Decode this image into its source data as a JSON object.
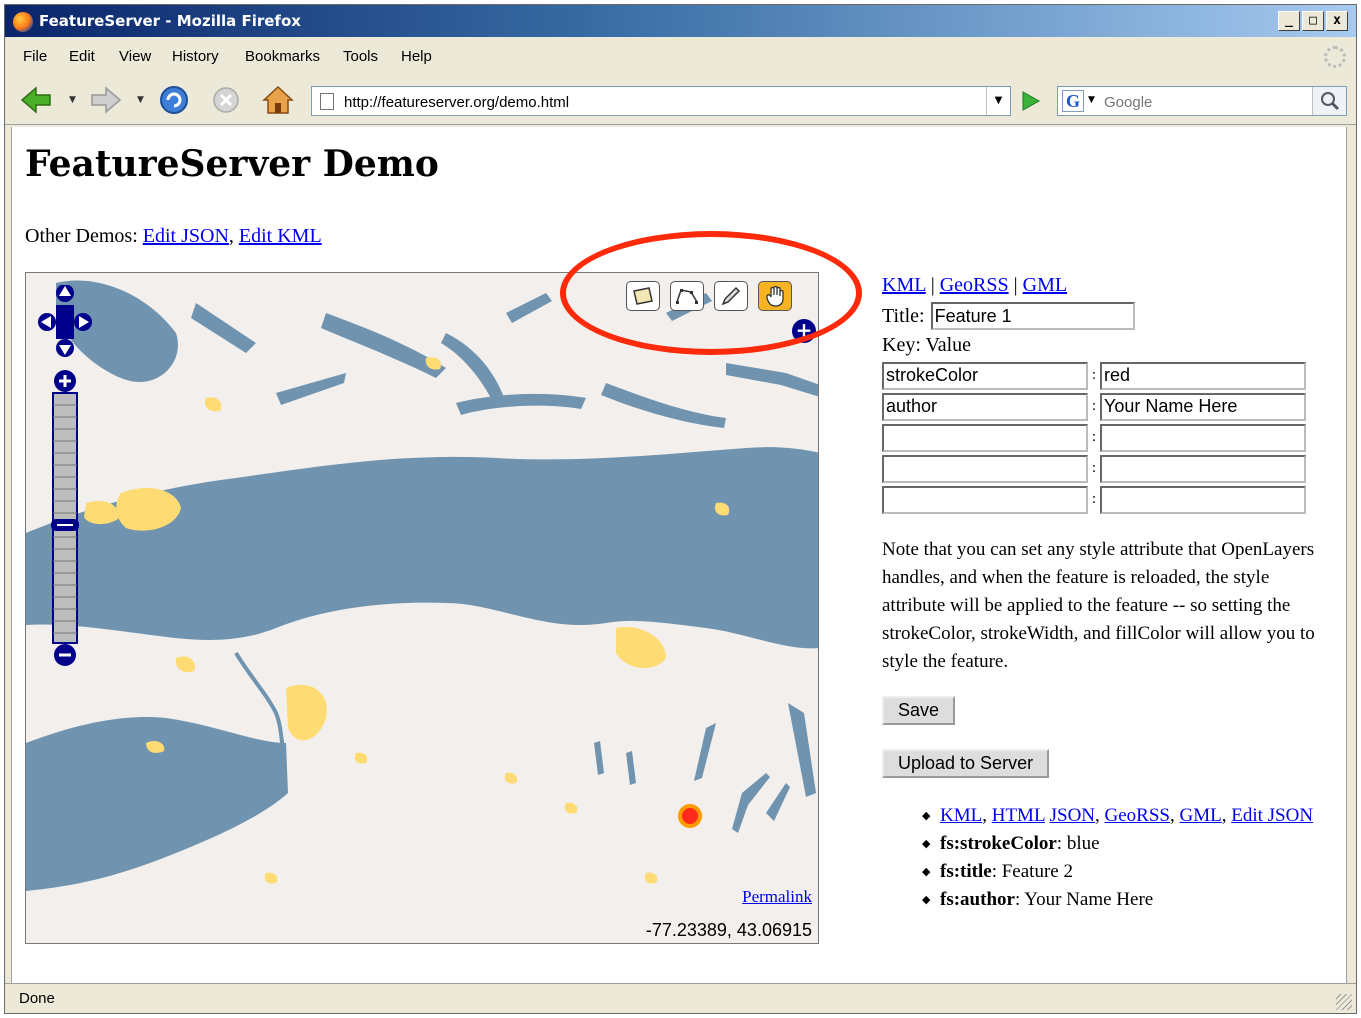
{
  "window": {
    "title": "FeatureServer - Mozilla Firefox",
    "min": "_",
    "max": "□",
    "close": "x"
  },
  "menu": [
    "File",
    "Edit",
    "View",
    "History",
    "Bookmarks",
    "Tools",
    "Help"
  ],
  "nav": {
    "url": "http://featureserver.org/demo.html",
    "search_placeholder": "Google"
  },
  "page": {
    "title": "FeatureServer Demo",
    "other_demos_label": "Other Demos:",
    "other_demos": [
      "Edit JSON",
      "Edit KML"
    ]
  },
  "map": {
    "permalink": "Permalink",
    "coords": "-77.23389, 43.06915",
    "tools": [
      "draw-polygon",
      "draw-line",
      "modify-feature",
      "pan-hand"
    ],
    "colors": {
      "water": "#7094b0",
      "land": "#f2efec",
      "urban": "#fedc73",
      "marker": "#ff2a1a",
      "annotation": "#ff2a0a"
    }
  },
  "side": {
    "formats": [
      "KML",
      "GeoRSS",
      "GML"
    ],
    "title_label": "Title:",
    "title_value": "Feature 1",
    "kv_header": "Key: Value",
    "kv": [
      {
        "key": "strokeColor",
        "value": "red"
      },
      {
        "key": "author",
        "value": "Your Name Here"
      },
      {
        "key": "",
        "value": ""
      },
      {
        "key": "",
        "value": ""
      },
      {
        "key": "",
        "value": ""
      }
    ],
    "note": "Note that you can set any style attribute that OpenLayers handles, and when the feature is reloaded, the style attribute will be applied to the feature -- so setting the strokeColor, strokeWidth, and fillColor will allow you to style the feature.",
    "save": "Save",
    "upload": "Upload to Server",
    "feature_links": [
      "KML",
      "HTML",
      "JSON",
      "GeoRSS",
      "GML",
      "Edit JSON"
    ],
    "attrs": [
      {
        "name": "fs:strokeColor",
        "value": ": blue"
      },
      {
        "name": "fs:title",
        "value": ": Feature 2"
      },
      {
        "name": "fs:author",
        "value": ": Your Name Here"
      }
    ]
  },
  "status": "Done"
}
